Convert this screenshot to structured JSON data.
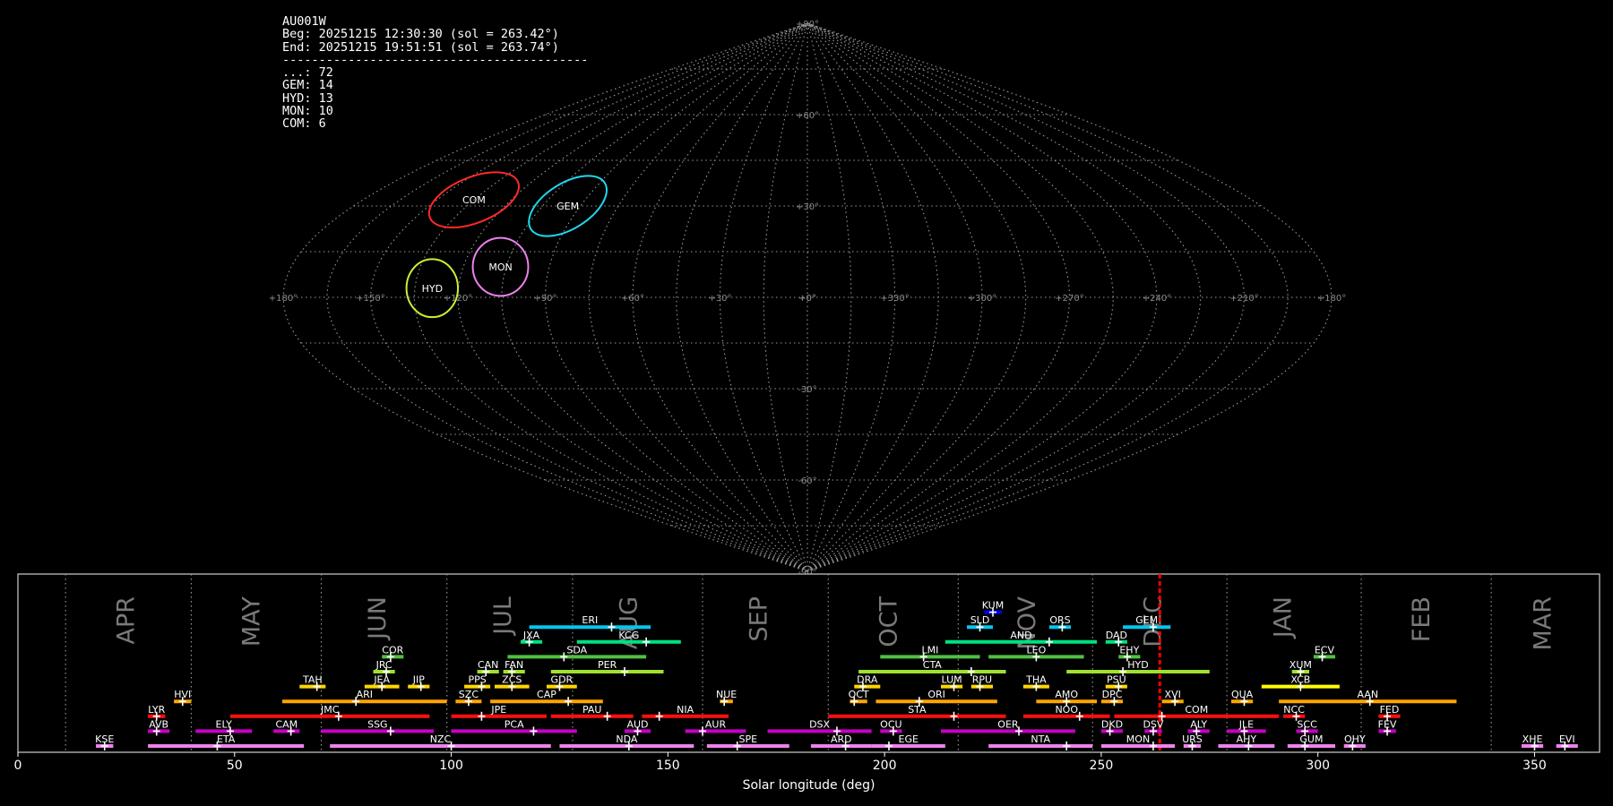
{
  "station": {
    "id": "AU001W",
    "begin": "Beg: 20251215 12:30:30 (sol = 263.42°)",
    "end": "End: 20251215 19:51:51 (sol = 263.74°)",
    "separator": "------------------------------------------",
    "counts": [
      "...: 72",
      "GEM: 14",
      "HYD: 13",
      "MON: 10",
      "COM: 6"
    ]
  },
  "colors": {
    "background": "#000000",
    "grid": "#9a9a9a",
    "current": "#ff0000"
  },
  "chart_data": [
    {
      "type": "scatter",
      "projection": "sinusoidal",
      "description_of_axes": "radiant map, ecliptic longitude vs latitude",
      "lon_ticks": [
        "+180°",
        "+150°",
        "+120°",
        "+90°",
        "+60°",
        "+30°",
        "+0°",
        "+330°",
        "+300°",
        "+270°",
        "+240°",
        "+210°",
        "+180°"
      ],
      "lat_ticks": [
        "+90°",
        "+60°",
        "+30°",
        "+0°",
        "-30°",
        "-60°",
        "-90°"
      ],
      "radiants": [
        {
          "name": "COM",
          "lon": 135,
          "lat": 32,
          "color": "#ff2a2a",
          "w": 24,
          "h": 11,
          "rot": -22
        },
        {
          "name": "GEM",
          "lon": 95,
          "lat": 30,
          "color": "#20d8ee",
          "w": 22,
          "h": 11,
          "rot": -32
        },
        {
          "name": "HYD",
          "lon": 129,
          "lat": 3,
          "color": "#c8f032",
          "w": 13,
          "h": 14,
          "rot": 0
        },
        {
          "name": "MON",
          "lon": 107,
          "lat": 10,
          "color": "#ee82ee",
          "w": 14,
          "h": 14,
          "rot": 0
        }
      ]
    },
    {
      "type": "bar",
      "description_of_axes": "meteor shower activity periods vs solar longitude",
      "xlabel": "Solar longitude (deg)",
      "xlim": [
        0,
        365
      ],
      "xticks": [
        0,
        50,
        100,
        150,
        200,
        250,
        300,
        350
      ],
      "current_sol": 263.5,
      "month_boundaries": [
        11,
        40,
        70,
        99,
        128,
        158,
        187,
        217,
        248,
        279,
        310,
        340
      ],
      "months": [
        {
          "label": "APR",
          "x": 25
        },
        {
          "label": "MAY",
          "x": 54
        },
        {
          "label": "JUN",
          "x": 83
        },
        {
          "label": "JUL",
          "x": 112
        },
        {
          "label": "AUG",
          "x": 141
        },
        {
          "label": "SEP",
          "x": 171
        },
        {
          "label": "OCT",
          "x": 201
        },
        {
          "label": "NOV",
          "x": 233
        },
        {
          "label": "DEC",
          "x": 262
        },
        {
          "label": "JAN",
          "x": 292
        },
        {
          "label": "FEB",
          "x": 324
        },
        {
          "label": "MAR",
          "x": 352
        }
      ],
      "showers": [
        {
          "code": "KSE",
          "start": 18,
          "end": 22,
          "peak": 20,
          "row": 0,
          "color": "#ee82ee"
        },
        {
          "code": "ETA",
          "start": 30,
          "end": 66,
          "peak": 46,
          "row": 0,
          "color": "#ee82ee"
        },
        {
          "code": "NZC",
          "start": 72,
          "end": 123,
          "peak": 100,
          "row": 0,
          "color": "#ee82ee"
        },
        {
          "code": "NDA",
          "start": 125,
          "end": 156,
          "peak": 141,
          "row": 0,
          "color": "#ee82ee"
        },
        {
          "code": "SPE",
          "start": 159,
          "end": 178,
          "peak": 166,
          "row": 0,
          "color": "#ee82ee"
        },
        {
          "code": "ARD",
          "start": 183,
          "end": 197,
          "peak": 191,
          "row": 0,
          "color": "#ee82ee"
        },
        {
          "code": "EGE",
          "start": 197,
          "end": 214,
          "peak": 201,
          "row": 0,
          "color": "#ee82ee"
        },
        {
          "code": "NTA",
          "start": 224,
          "end": 248,
          "peak": 242,
          "row": 0,
          "color": "#ee82ee"
        },
        {
          "code": "MON",
          "start": 250,
          "end": 267,
          "peak": 262,
          "row": 0,
          "color": "#ee82ee"
        },
        {
          "code": "URS",
          "start": 269,
          "end": 273,
          "peak": 271,
          "row": 0,
          "color": "#ee82ee"
        },
        {
          "code": "AHY",
          "start": 277,
          "end": 290,
          "peak": 284,
          "row": 0,
          "color": "#ee82ee"
        },
        {
          "code": "GUM",
          "start": 293,
          "end": 304,
          "peak": 297,
          "row": 0,
          "color": "#ee82ee"
        },
        {
          "code": "OHY",
          "start": 306,
          "end": 311,
          "peak": 308,
          "row": 0,
          "color": "#ee82ee"
        },
        {
          "code": "XHE",
          "start": 347,
          "end": 352,
          "peak": 350,
          "row": 0,
          "color": "#ee82ee"
        },
        {
          "code": "EVI",
          "start": 355,
          "end": 360,
          "peak": 357,
          "row": 0,
          "color": "#ee82ee"
        },
        {
          "code": "AVB",
          "start": 30,
          "end": 35,
          "peak": 32,
          "row": 1,
          "color": "#c800c8"
        },
        {
          "code": "ELY",
          "start": 41,
          "end": 54,
          "peak": 49,
          "row": 1,
          "color": "#c800c8"
        },
        {
          "code": "CAM",
          "start": 59,
          "end": 65,
          "peak": 63,
          "row": 1,
          "color": "#c800c8"
        },
        {
          "code": "SSG",
          "start": 70,
          "end": 96,
          "peak": 86,
          "row": 1,
          "color": "#c800c8"
        },
        {
          "code": "PCA",
          "start": 100,
          "end": 129,
          "peak": 119,
          "row": 1,
          "color": "#c800c8"
        },
        {
          "code": "AUD",
          "start": 140,
          "end": 146,
          "peak": 143,
          "row": 1,
          "color": "#c800c8"
        },
        {
          "code": "AUR",
          "start": 154,
          "end": 168,
          "peak": 158,
          "row": 1,
          "color": "#c800c8"
        },
        {
          "code": "DSX",
          "start": 173,
          "end": 197,
          "peak": 189,
          "row": 1,
          "color": "#c800c8"
        },
        {
          "code": "OCU",
          "start": 199,
          "end": 204,
          "peak": 202,
          "row": 1,
          "color": "#c800c8"
        },
        {
          "code": "OER",
          "start": 213,
          "end": 244,
          "peak": 231,
          "row": 1,
          "color": "#c800c8"
        },
        {
          "code": "DKD",
          "start": 250,
          "end": 255,
          "peak": 252,
          "row": 1,
          "color": "#c800c8"
        },
        {
          "code": "DSV",
          "start": 260,
          "end": 264,
          "peak": 262,
          "row": 1,
          "color": "#c800c8"
        },
        {
          "code": "ALY",
          "start": 270,
          "end": 275,
          "peak": 272,
          "row": 1,
          "color": "#c800c8"
        },
        {
          "code": "JLE",
          "start": 279,
          "end": 288,
          "peak": 283,
          "row": 1,
          "color": "#c800c8"
        },
        {
          "code": "SCC",
          "start": 295,
          "end": 300,
          "peak": 297,
          "row": 1,
          "color": "#c800c8"
        },
        {
          "code": "FEV",
          "start": 314,
          "end": 318,
          "peak": 316,
          "row": 1,
          "color": "#c800c8"
        },
        {
          "code": "LYR",
          "start": 30,
          "end": 34,
          "peak": 32,
          "row": 2,
          "color": "#ff1010"
        },
        {
          "code": "JMC",
          "start": 49,
          "end": 95,
          "peak": 74,
          "row": 2,
          "color": "#ff1010"
        },
        {
          "code": "JPE",
          "start": 100,
          "end": 122,
          "peak": 107,
          "row": 2,
          "color": "#ff1010"
        },
        {
          "code": "PAU",
          "start": 123,
          "end": 142,
          "peak": 136,
          "row": 2,
          "color": "#ff1010"
        },
        {
          "code": "NIA",
          "start": 144,
          "end": 164,
          "peak": 148,
          "row": 2,
          "color": "#ff1010"
        },
        {
          "code": "STA",
          "start": 187,
          "end": 228,
          "peak": 216,
          "row": 2,
          "color": "#ff1010"
        },
        {
          "code": "NOO",
          "start": 232,
          "end": 252,
          "peak": 245,
          "row": 2,
          "color": "#ff1010"
        },
        {
          "code": "COM",
          "start": 253,
          "end": 291,
          "peak": 264,
          "row": 2,
          "color": "#ff1010"
        },
        {
          "code": "NCC",
          "start": 292,
          "end": 297,
          "peak": 295,
          "row": 2,
          "color": "#ff1010"
        },
        {
          "code": "FED",
          "start": 314,
          "end": 319,
          "peak": 316,
          "row": 2,
          "color": "#ff1010"
        },
        {
          "code": "HVI",
          "start": 36,
          "end": 40,
          "peak": 38,
          "row": 3,
          "color": "#ffa500"
        },
        {
          "code": "ARI",
          "start": 61,
          "end": 99,
          "peak": 78,
          "row": 3,
          "color": "#ffa500"
        },
        {
          "code": "SZC",
          "start": 101,
          "end": 107,
          "peak": 104,
          "row": 3,
          "color": "#ffa500"
        },
        {
          "code": "CAP",
          "start": 109,
          "end": 135,
          "peak": 127,
          "row": 3,
          "color": "#ffa500"
        },
        {
          "code": "NUE",
          "start": 162,
          "end": 165,
          "peak": 163,
          "row": 3,
          "color": "#ffa500"
        },
        {
          "code": "OCT",
          "start": 192,
          "end": 196,
          "peak": 193,
          "row": 3,
          "color": "#ffa500"
        },
        {
          "code": "ORI",
          "start": 198,
          "end": 226,
          "peak": 208,
          "row": 3,
          "color": "#ffa500"
        },
        {
          "code": "AMO",
          "start": 235,
          "end": 249,
          "peak": 242,
          "row": 3,
          "color": "#ffa500"
        },
        {
          "code": "DPC",
          "start": 250,
          "end": 255,
          "peak": 253,
          "row": 3,
          "color": "#ffa500"
        },
        {
          "code": "XVI",
          "start": 264,
          "end": 269,
          "peak": 267,
          "row": 3,
          "color": "#ffa500"
        },
        {
          "code": "QUA",
          "start": 280,
          "end": 285,
          "peak": 283,
          "row": 3,
          "color": "#ffa500"
        },
        {
          "code": "AAN",
          "start": 291,
          "end": 332,
          "peak": 312,
          "row": 3,
          "color": "#ffa500"
        },
        {
          "code": "TAH",
          "start": 65,
          "end": 71,
          "peak": 69,
          "row": 4,
          "color": "#ffd700"
        },
        {
          "code": "JEA",
          "start": 80,
          "end": 88,
          "peak": 84,
          "row": 4,
          "color": "#ffd700"
        },
        {
          "code": "JIP",
          "start": 90,
          "end": 95,
          "peak": 93,
          "row": 4,
          "color": "#ffd700"
        },
        {
          "code": "PPS",
          "start": 103,
          "end": 109,
          "peak": 107,
          "row": 4,
          "color": "#ffd700"
        },
        {
          "code": "ZCS",
          "start": 110,
          "end": 118,
          "peak": 114,
          "row": 4,
          "color": "#ffd700"
        },
        {
          "code": "GDR",
          "start": 122,
          "end": 129,
          "peak": 125,
          "row": 4,
          "color": "#ffd700"
        },
        {
          "code": "DRA",
          "start": 193,
          "end": 199,
          "peak": 195,
          "row": 4,
          "color": "#ffd700"
        },
        {
          "code": "LUM",
          "start": 213,
          "end": 218,
          "peak": 216,
          "row": 4,
          "color": "#ffd700"
        },
        {
          "code": "RPU",
          "start": 220,
          "end": 225,
          "peak": 222,
          "row": 4,
          "color": "#ffd700"
        },
        {
          "code": "THA",
          "start": 232,
          "end": 238,
          "peak": 235,
          "row": 4,
          "color": "#ffd700"
        },
        {
          "code": "PSU",
          "start": 251,
          "end": 256,
          "peak": 254,
          "row": 4,
          "color": "#ffd700"
        },
        {
          "code": "XCB",
          "start": 287,
          "end": 305,
          "peak": 296,
          "row": 4,
          "color": "#ffff00"
        },
        {
          "code": "JRC",
          "start": 82,
          "end": 87,
          "peak": 85,
          "row": 5,
          "color": "#a0e030"
        },
        {
          "code": "CAN",
          "start": 106,
          "end": 111,
          "peak": 108,
          "row": 5,
          "color": "#a0e030"
        },
        {
          "code": "FAN",
          "start": 112,
          "end": 117,
          "peak": 114,
          "row": 5,
          "color": "#a0e030"
        },
        {
          "code": "PER",
          "start": 123,
          "end": 149,
          "peak": 140,
          "row": 5,
          "color": "#a0e030"
        },
        {
          "code": "CTA",
          "start": 194,
          "end": 228,
          "peak": 220,
          "row": 5,
          "color": "#a0e030"
        },
        {
          "code": "HYD",
          "start": 242,
          "end": 275,
          "peak": 255,
          "row": 5,
          "color": "#a0e030"
        },
        {
          "code": "XUM",
          "start": 294,
          "end": 298,
          "peak": 296,
          "row": 5,
          "color": "#a0e030"
        },
        {
          "code": "COR",
          "start": 84,
          "end": 89,
          "peak": 86,
          "row": 6,
          "color": "#50c040"
        },
        {
          "code": "SDA",
          "start": 113,
          "end": 145,
          "peak": 126,
          "row": 6,
          "color": "#50c040"
        },
        {
          "code": "LMI",
          "start": 199,
          "end": 222,
          "peak": 209,
          "row": 6,
          "color": "#50c040"
        },
        {
          "code": "LEO",
          "start": 224,
          "end": 246,
          "peak": 235,
          "row": 6,
          "color": "#50c040"
        },
        {
          "code": "EHY",
          "start": 254,
          "end": 259,
          "peak": 256,
          "row": 6,
          "color": "#50c040"
        },
        {
          "code": "ECV",
          "start": 299,
          "end": 304,
          "peak": 301,
          "row": 6,
          "color": "#50c040"
        },
        {
          "code": "JXA",
          "start": 116,
          "end": 121,
          "peak": 118,
          "row": 7,
          "color": "#00e080"
        },
        {
          "code": "KCG",
          "start": 129,
          "end": 153,
          "peak": 145,
          "row": 7,
          "color": "#00e080"
        },
        {
          "code": "AND",
          "start": 214,
          "end": 249,
          "peak": 238,
          "row": 7,
          "color": "#00e080"
        },
        {
          "code": "DAD",
          "start": 251,
          "end": 256,
          "peak": 254,
          "row": 7,
          "color": "#00e080"
        },
        {
          "code": "ERI",
          "start": 118,
          "end": 146,
          "peak": 137,
          "row": 8,
          "color": "#00c8f0"
        },
        {
          "code": "SLD",
          "start": 219,
          "end": 225,
          "peak": 222,
          "row": 8,
          "color": "#00c8f0"
        },
        {
          "code": "ORS",
          "start": 238,
          "end": 243,
          "peak": 241,
          "row": 8,
          "color": "#00c8f0"
        },
        {
          "code": "GEM",
          "start": 255,
          "end": 266,
          "peak": 262,
          "row": 8,
          "color": "#00c8f0"
        },
        {
          "code": "KUM",
          "start": 223,
          "end": 227,
          "peak": 225,
          "row": 9,
          "color": "#0000ff"
        }
      ]
    }
  ]
}
